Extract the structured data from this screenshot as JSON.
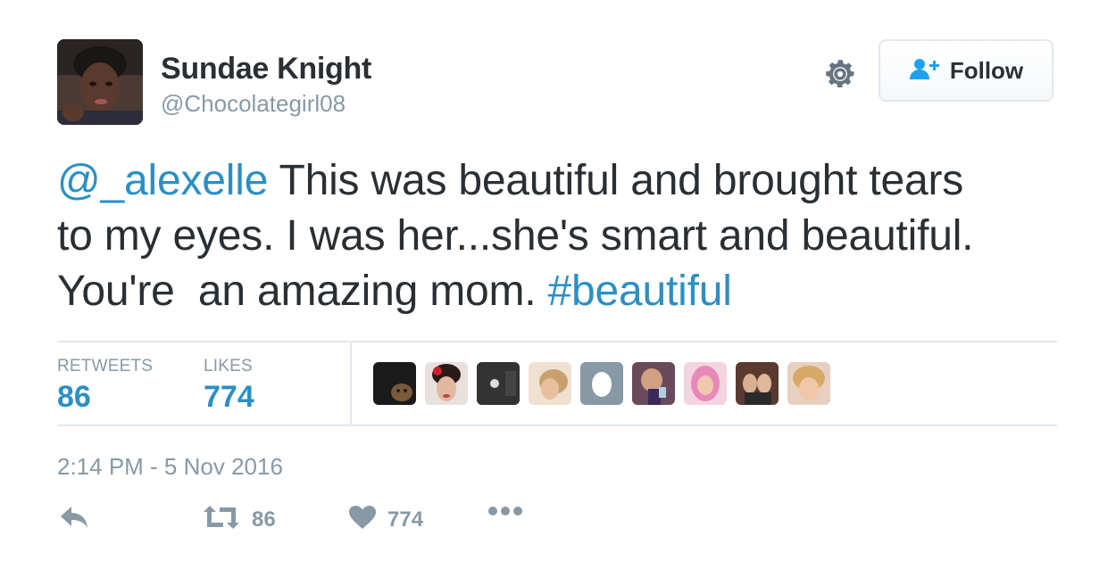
{
  "user": {
    "name": "Sundae Knight",
    "handle": "@Chocolategirl08"
  },
  "follow_button": {
    "label": "Follow"
  },
  "tweet": {
    "mention": "@_alexelle",
    "text_line1": " This was beautiful and brought tears",
    "text_line2": "to my eyes. I was her...she's smart and beautiful.",
    "text_line3": "You're  an amazing mom. ",
    "hashtag": "#beautiful"
  },
  "stats": {
    "retweets_label": "RETWEETS",
    "retweets_value": "86",
    "likes_label": "LIKES",
    "likes_value": "774"
  },
  "timestamp": "2:14 PM - 5 Nov 2016",
  "actions": {
    "retweet_count": "86",
    "like_count": "774"
  },
  "colors": {
    "link": "#2b8fc5",
    "muted": "#8899a6",
    "text": "#292f33",
    "divider": "#e1e8ed"
  },
  "icons": [
    "gear-icon",
    "follow-person-icon",
    "reply-icon",
    "retweet-icon",
    "heart-icon",
    "more-icon"
  ]
}
